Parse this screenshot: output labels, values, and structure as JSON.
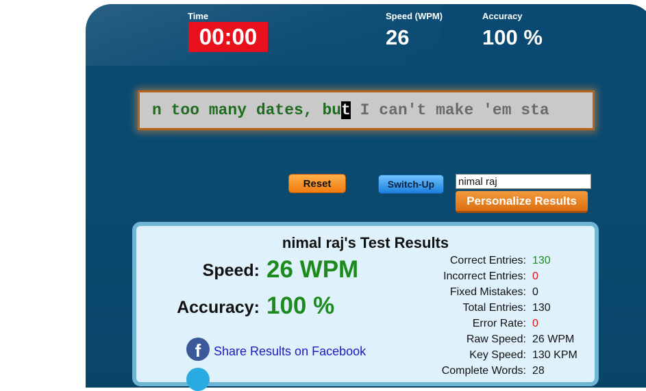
{
  "stats": {
    "time_label": "Time",
    "time_value": "00:00",
    "speed_label": "Speed (WPM)",
    "speed_value": "26",
    "accuracy_label": "Accuracy",
    "accuracy_value": "100 %"
  },
  "typing": {
    "typed_text": "n too many dates, bu",
    "cursor_char": "t",
    "remaining_text": " I can't make 'em sta"
  },
  "controls": {
    "reset_label": "Reset",
    "switch_label": "Switch-Up",
    "name_value": "nimal raj",
    "personalize_label": "Personalize Results"
  },
  "results": {
    "title": "nimal raj's Test Results",
    "speed_label": "Speed:",
    "speed_value": "26 WPM",
    "accuracy_label": "Accuracy:",
    "accuracy_value": "100 %",
    "share_facebook": "Share Results on Facebook",
    "details": [
      {
        "label": "Correct Entries:",
        "value": "130"
      },
      {
        "label": "Incorrect Entries:",
        "value": "0"
      },
      {
        "label": "Fixed Mistakes:",
        "value": "0"
      },
      {
        "label": "Total Entries:",
        "value": "130"
      },
      {
        "label": "Error Rate:",
        "value": "0"
      },
      {
        "label": "Raw Speed:",
        "value": "26 WPM"
      },
      {
        "label": "Key Speed:",
        "value": "130 KPM"
      },
      {
        "label": "Complete Words:",
        "value": "28"
      }
    ]
  },
  "colors": {
    "panel": "#0a4a72",
    "timer_bg": "#e8101a",
    "accent_green": "#1c8a1c",
    "error_red": "#e01010"
  }
}
